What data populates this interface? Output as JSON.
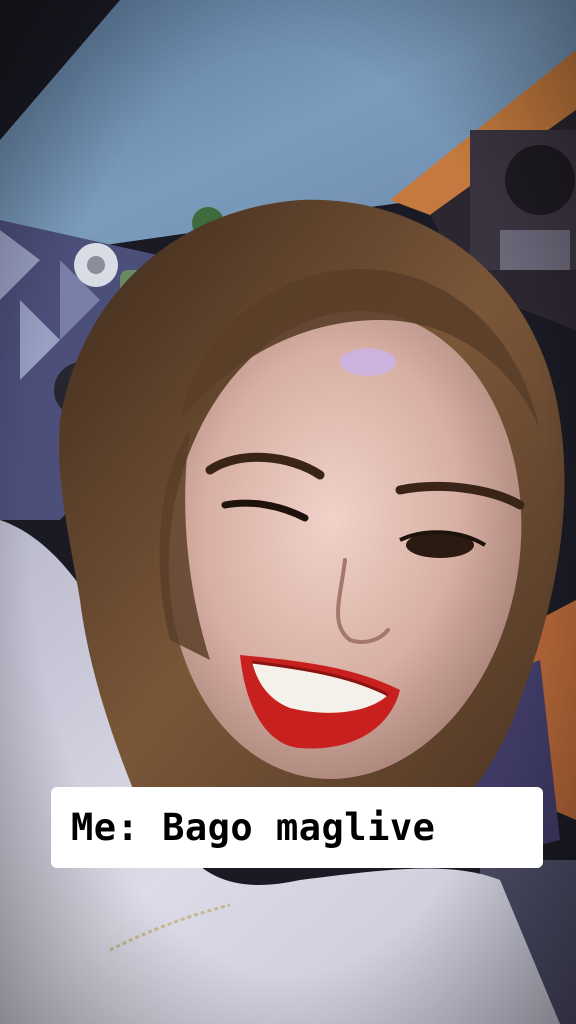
{
  "caption": {
    "text": "Me: Bago maglive"
  },
  "photo": {
    "subject": "selfie of a smiling person lying on a bed",
    "colors": {
      "bed_sheet": "#6f8fb0",
      "wood_headboard": "#c77a3a",
      "hair": "#6b4a2e",
      "skin": "#d9b3a6",
      "lips": "#c8201f",
      "shirt": "#d6d6e2",
      "caption_bg": "#ffffff",
      "caption_text": "#000000"
    }
  }
}
